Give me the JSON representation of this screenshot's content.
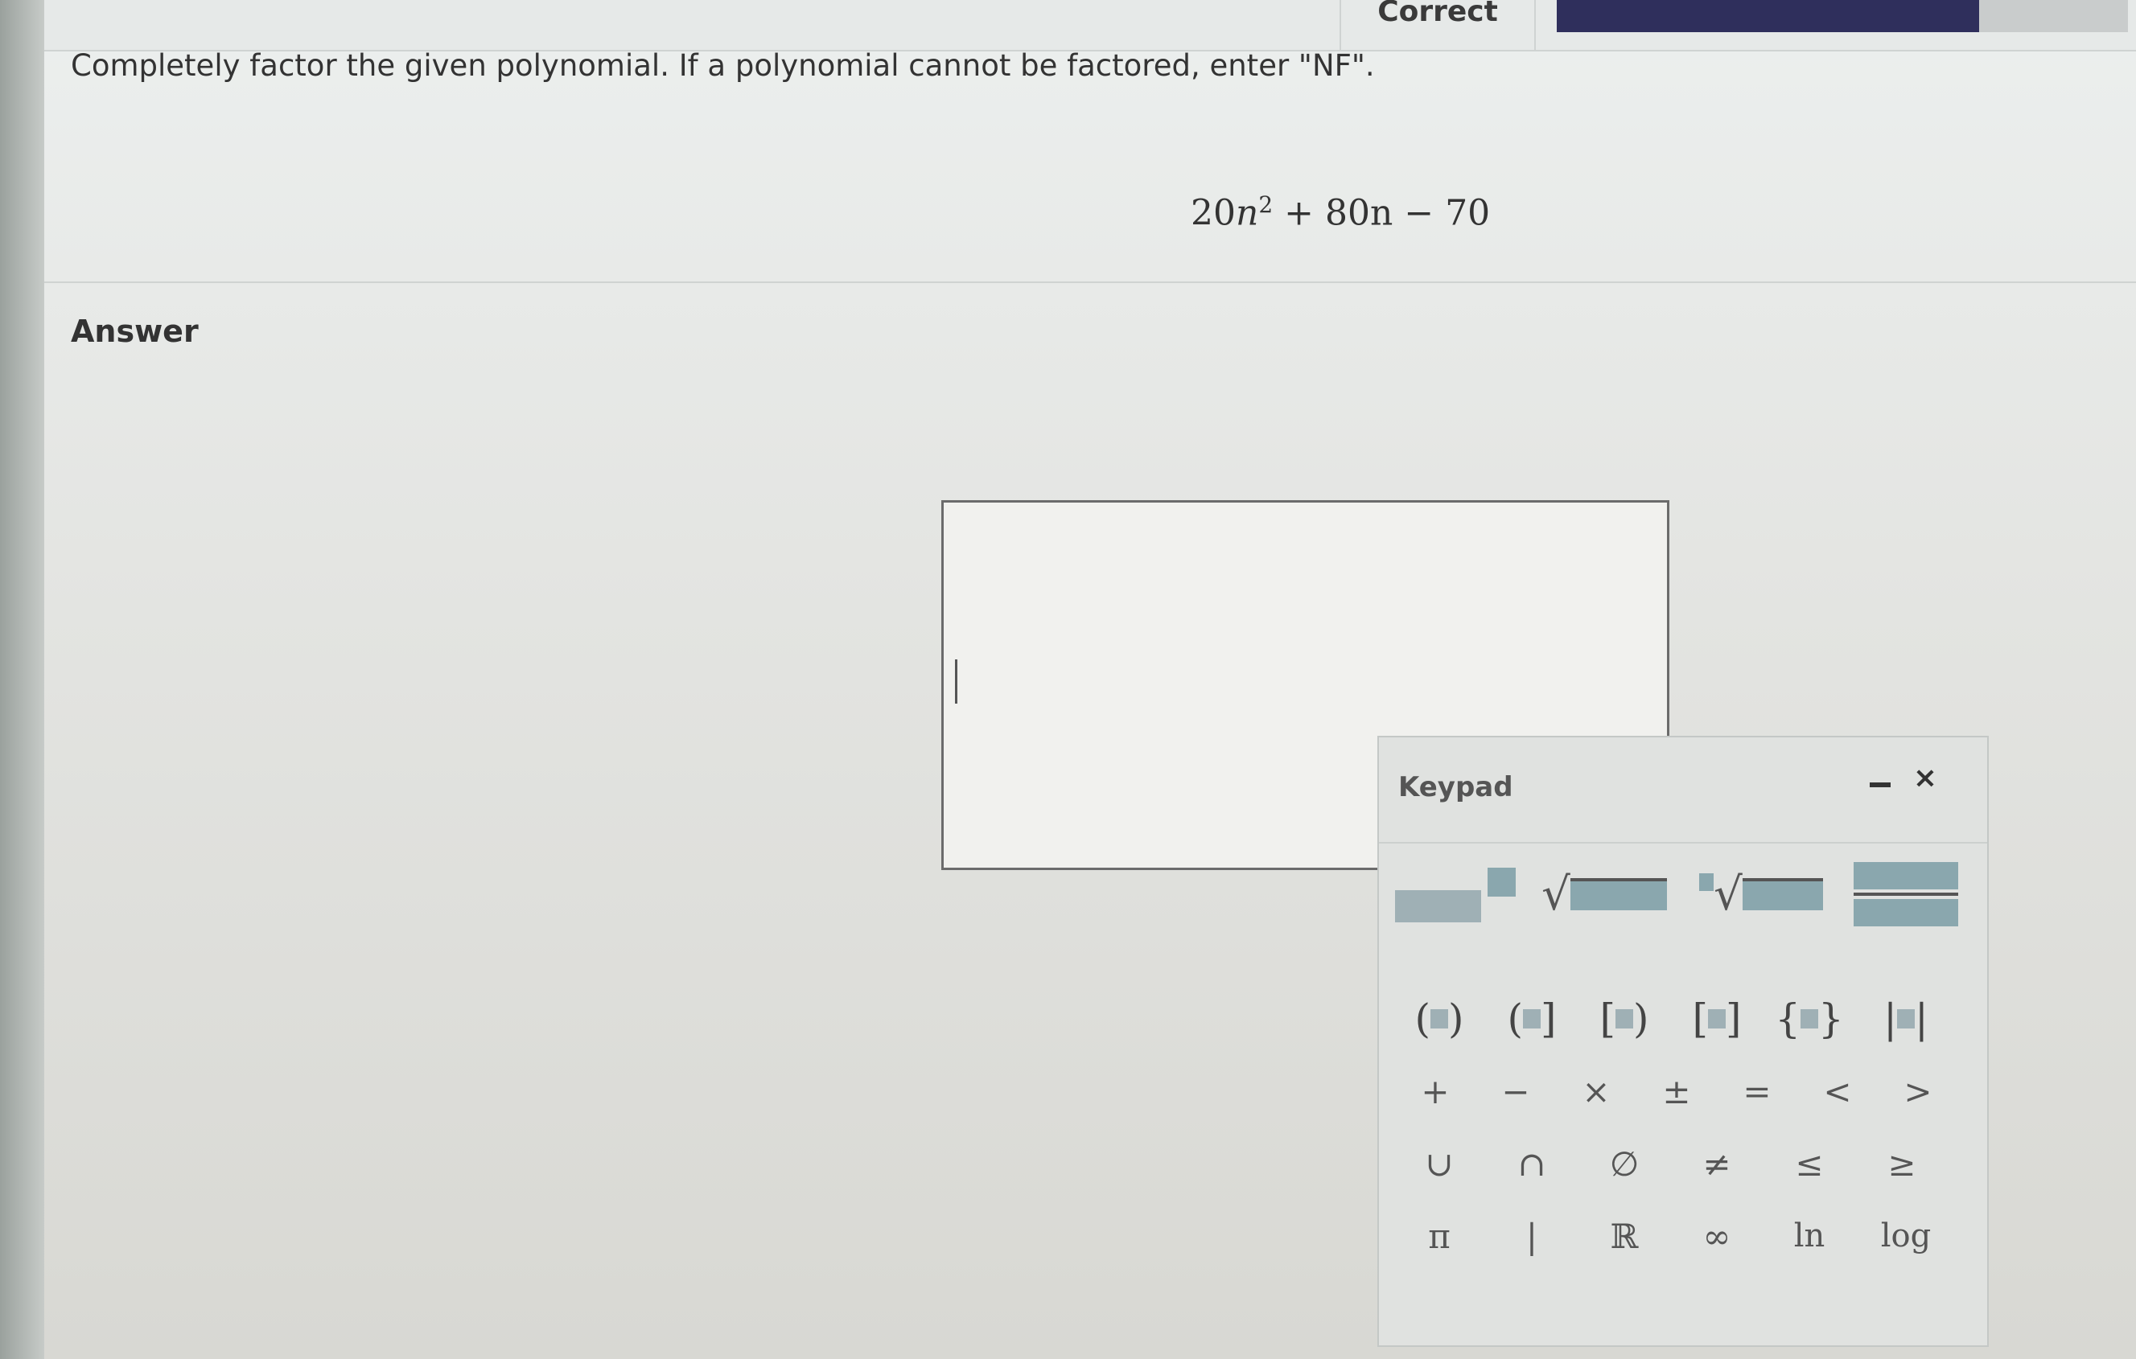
{
  "header": {
    "status": "Correct",
    "progress": 0.74
  },
  "question": {
    "prompt": "Completely factor the given polynomial. If a polynomial cannot be factored, enter \"NF\".",
    "expression": {
      "coef1": "20",
      "var1": "n",
      "exponent": "2",
      "rest": "+ 80n − 70"
    }
  },
  "answer": {
    "label": "Answer",
    "value": ""
  },
  "keypad": {
    "title": "Keypad",
    "minimize_glyph": "−",
    "close_glyph": "×",
    "row_templates": [
      "exponent",
      "square-root",
      "nth-root",
      "fraction"
    ],
    "row_brackets": [
      "(",
      ")",
      "(",
      "]",
      "[",
      ")",
      "[",
      "]",
      "{",
      "}",
      "|",
      "|"
    ],
    "row_operators": [
      "+",
      "−",
      "×",
      "±",
      "=",
      "<",
      ">"
    ],
    "row_sets": [
      "∪",
      "∩",
      "∅",
      "≠",
      "≤",
      "≥"
    ],
    "row_misc": [
      "π",
      "|",
      "ℝ",
      "∞",
      "ln",
      "log"
    ]
  }
}
